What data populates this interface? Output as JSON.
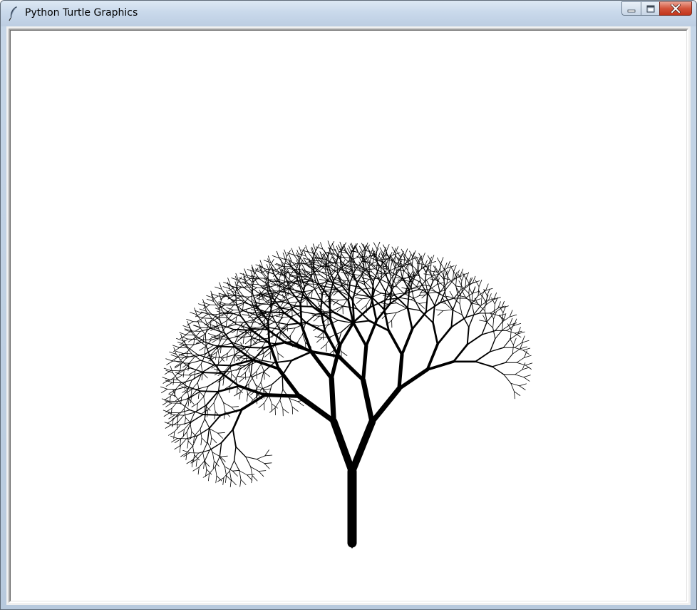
{
  "window": {
    "title": "Python Turtle Graphics",
    "icon": "feather-icon",
    "controls": [
      "minimize-icon",
      "maximize-icon",
      "close-icon"
    ],
    "colors": {
      "titlebar": "#c9d9eb",
      "close_button": "#c94a30",
      "canvas_background": "#ffffff"
    }
  },
  "canvas": {
    "drawing": "fractal-tree",
    "pen_color": "#000000",
    "turtle_shape": "classic-arrow"
  }
}
